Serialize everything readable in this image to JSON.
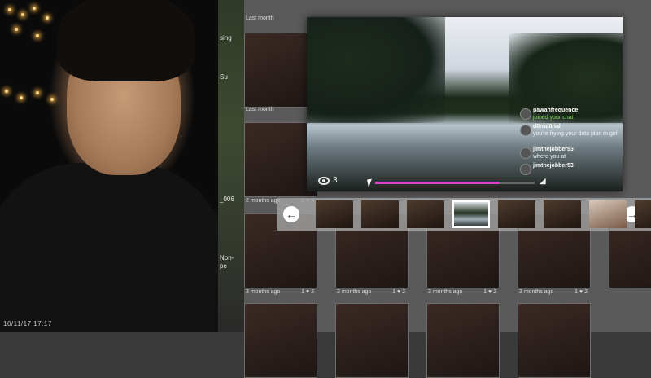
{
  "webcam": {
    "timestamp": "10/11/17 17:17"
  },
  "side_strip": {
    "texts": [
      "sing",
      "Su",
      "_006",
      "Non-",
      "pe"
    ]
  },
  "grid": {
    "cells": [
      {
        "time": "Last month",
        "likes": "",
        "comments": ""
      },
      {
        "time": "Last month",
        "likes": "",
        "comments": ""
      },
      {
        "time": "2 months ago",
        "likes": "1",
        "comments": "3"
      },
      {
        "time": "3 months ago",
        "likes": "1",
        "comments": "2"
      },
      {
        "time": "3 months ago",
        "likes": "1",
        "comments": "2"
      },
      {
        "time": "3 months ago",
        "likes": "1",
        "comments": "2"
      },
      {
        "time": "3 months ago",
        "likes": "1",
        "comments": "2"
      }
    ]
  },
  "player": {
    "view_count": "3",
    "progress": 0.78,
    "chat": [
      {
        "user": "pawanfrequence",
        "msg": "joined your chat",
        "green": true
      },
      {
        "user": "d0rnd0rial",
        "msg": "you're frying your data plan m girl",
        "green": false
      },
      {
        "user": "jimthejobber53",
        "msg": "where you at",
        "green": false
      },
      {
        "user": "jimthejobber53",
        "msg": "",
        "green": false
      }
    ]
  },
  "filmstrip": {
    "prev_label": "←",
    "next_label": "→",
    "thumb_count": 8,
    "selected_index": 3
  },
  "icons": {
    "views": "eye-icon",
    "volume": "volume-icon",
    "prev": "arrow-left-icon",
    "next": "arrow-right-icon"
  }
}
